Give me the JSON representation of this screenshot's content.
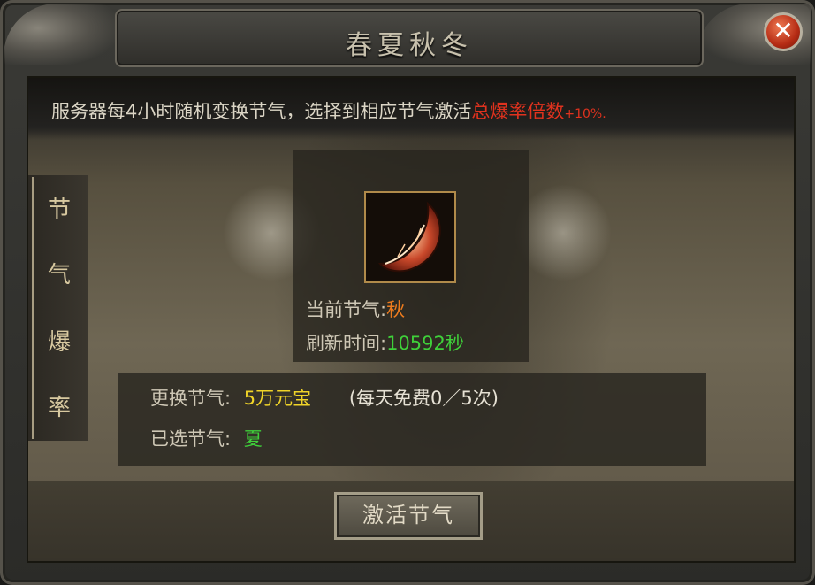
{
  "window": {
    "title": "春夏秋冬",
    "close_symbol": "✕"
  },
  "info": {
    "text": "服务器每4小时随机变换节气，选择到相应节气激活",
    "highlight": "总爆率倍数",
    "bonus": "+10%."
  },
  "side_tab": {
    "chars": [
      "节",
      "气",
      "爆",
      "率"
    ]
  },
  "status": {
    "current_label": "当前节气:",
    "current_value": "秋",
    "refresh_label": "刷新时间:",
    "refresh_value": "10592秒"
  },
  "exchange": {
    "change_label": "更换节气:",
    "change_cost": "5万元宝",
    "free_note": "(每天免费0／5次)",
    "selected_label": "已选节气:",
    "selected_value": "夏"
  },
  "actions": {
    "activate_label": "激活节气"
  },
  "icons": {
    "item": "autumn-leaf-icon",
    "close": "close-icon"
  },
  "colors": {
    "highlight_red": "#e0321e",
    "orange": "#ec7b1e",
    "green": "#3fd03a",
    "yellow": "#f0d428"
  }
}
